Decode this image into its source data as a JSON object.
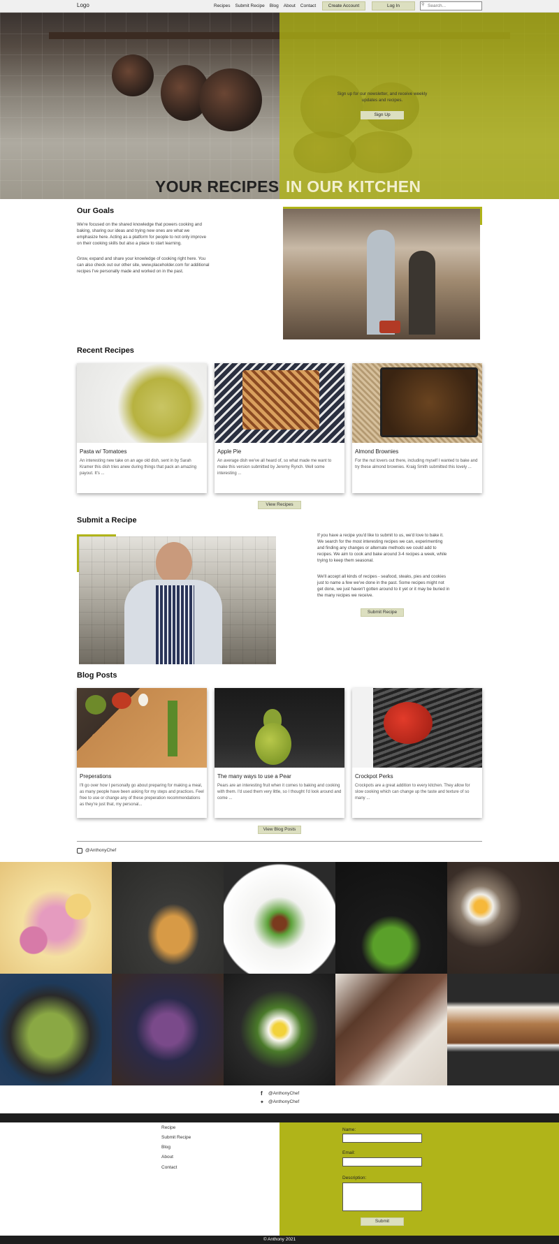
{
  "nav": {
    "logo": "Logo",
    "links": [
      "Recipes",
      "Submit Recipe",
      "Blog",
      "About",
      "Contact"
    ],
    "create_account": "Create Account",
    "login": "Log In",
    "search_placeholder": "Search..."
  },
  "hero": {
    "newsletter_text": "Sign up for our newsletter, and receive weekly updates and recipes.",
    "signup_button": "Sign Up",
    "title_left": "YOUR RECIPES",
    "title_right": "IN OUR KITCHEN"
  },
  "goals": {
    "heading": "Our Goals",
    "paragraph1": "We're focused on the shared knowledge that powers cooking and baking, sharing our ideas and trying new ones are what we emphasize here. Acting as a platform for people to not only improve on their cooking skills but also a place to start learning.",
    "paragraph2": "Grow, expand and share your knowledge of cooking right here. You can also check out our other site, www.placeholder.com for additional recipes I've personally made and worked on in the past."
  },
  "recent_recipes": {
    "heading": "Recent Recipes",
    "cards": [
      {
        "title": "Pasta w/ Tomatoes",
        "text": "An interesting new take on an age old dish, sent in by Sarah Kramer this dish tries anew during things that pack an amazing payout. It's ..."
      },
      {
        "title": "Apple Pie",
        "text": "An average dish we've all heard of, so what made me want to make this version submitted by Jeremy Rynch. Well some interesting ..."
      },
      {
        "title": "Almond Brownies",
        "text": "For the nut lovers out there, including myself I wanted to bake and try these almond brownies. Kraig Smith submitted this lovely ..."
      }
    ],
    "button": "View Recipes"
  },
  "submit": {
    "heading": "Submit a Recipe",
    "paragraph1": "If you have a recipe you'd like to submit to us, we'd love to bake it. We search for the most interesting recipes we can, experimenting and finding any changes or alternate methods we could add to recipes. We aim to cook and bake around 3-4 recipes a week, while trying to keep them seasonal.",
    "paragraph2": "We'll accept all kinds of recipes - seafood, steaks, pies and cookies just to name a few we've done in the past. Some recipes might not get done, we just haven't gotten around to it yet or it may be buried in the many recipes we receive.",
    "button": "Submit Recipe"
  },
  "blog": {
    "heading": "Blog Posts",
    "cards": [
      {
        "title": "Preperations",
        "text": "I'll go over how I personally go about preparing for making a meal, as many people have been asking for my steps and practices. Feel free to use or change any of these preperation recommendations as they're just that, my personal..."
      },
      {
        "title": "The many ways to use a Pear",
        "text": "Pears are an interesting fruit when it comes to baking and cooking with them. I'd used them very little, so I thought I'd look around and come ..."
      },
      {
        "title": "Crockpot Perks",
        "text": "Crockpots are a great addition to every kitchen. They allow for slow cooking which can change up the taste and texture of so many ..."
      }
    ],
    "button": "View Blog Posts"
  },
  "instagram": {
    "icon": "instagram-icon",
    "handle": "@AnthonyChef"
  },
  "social": {
    "facebook_icon": "facebook-icon",
    "facebook": "@AnthonyChef",
    "twitter_icon": "twitter-icon",
    "twitter": "@AnthonyChef"
  },
  "footer": {
    "links": [
      "Recipe",
      "Submit Recipe",
      "Blog",
      "About",
      "Contact"
    ],
    "name_label": "Name:",
    "email_label": "Email:",
    "description_label": "Description:",
    "submit_button": "Submit",
    "copyright": "© Anthony 2021"
  },
  "colors": {
    "accent": "#b0b419",
    "button": "#dcdfc0",
    "footer_dark": "#1e1e1e"
  }
}
